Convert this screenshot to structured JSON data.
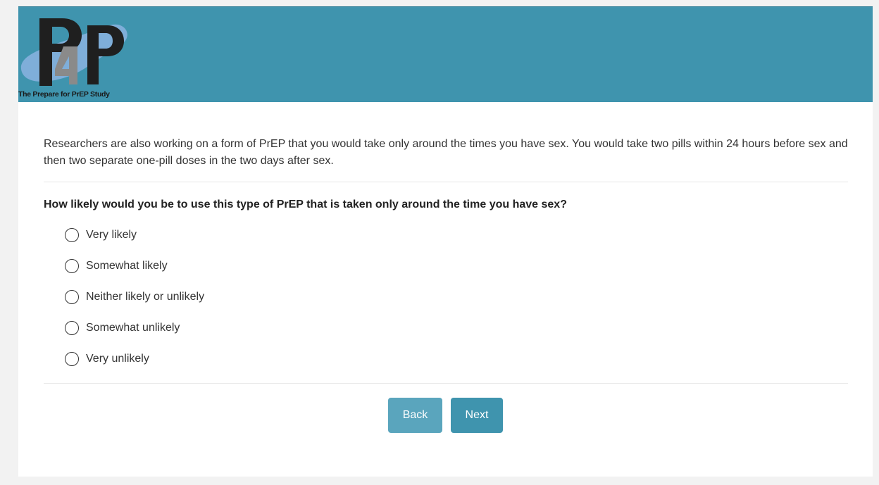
{
  "header": {
    "logo_caption": "The Prepare for PrEP Study",
    "logo_mark": "P4P",
    "colors": {
      "banner": "#3f94ae",
      "accent_blob": "#7faed9"
    }
  },
  "intro_text": "Researchers are also working on a form of PrEP that you would take only around the times you have sex. You would take two pills within 24 hours before sex and then two separate one-pill doses in the two days after sex.",
  "question": {
    "text": "How likely would you be to use this type of PrEP that is taken only around the time you have sex?",
    "options": [
      {
        "label": "Very likely",
        "selected": false
      },
      {
        "label": "Somewhat likely",
        "selected": false
      },
      {
        "label": "Neither likely or unlikely",
        "selected": false
      },
      {
        "label": "Somewhat unlikely",
        "selected": false
      },
      {
        "label": "Very unlikely",
        "selected": false
      }
    ]
  },
  "nav": {
    "back_label": "Back",
    "next_label": "Next"
  }
}
